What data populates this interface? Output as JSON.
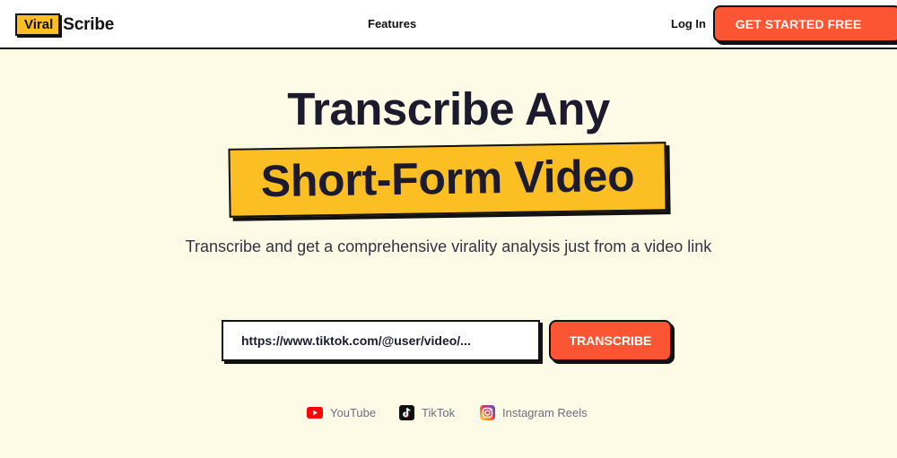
{
  "header": {
    "logo_badge": "Viral",
    "logo_text": "Scribe",
    "nav_features": "Features",
    "nav_login": "Log In",
    "cta_label": "GET STARTED FREE"
  },
  "hero": {
    "line1": "Transcribe Any",
    "line2": "Short-Form Video",
    "subtitle": "Transcribe and get a comprehensive virality analysis just from a video link"
  },
  "form": {
    "url_placeholder": "https://www.tiktok.com/@user/video/...",
    "submit_label": "TRANSCRIBE"
  },
  "platforms": [
    {
      "name": "YouTube",
      "icon": "youtube-icon"
    },
    {
      "name": "TikTok",
      "icon": "tiktok-icon"
    },
    {
      "name": "Instagram Reels",
      "icon": "instagram-icon"
    }
  ],
  "colors": {
    "background": "#fdfae6",
    "accent_orange": "#fb5533",
    "highlight_yellow": "#fbbf24",
    "text_dark": "#1c1b2e",
    "border": "#111111"
  }
}
